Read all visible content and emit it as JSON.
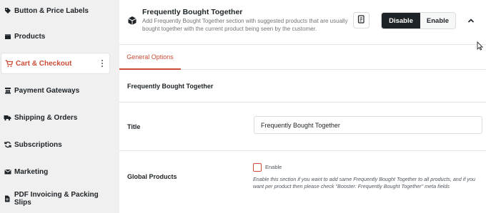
{
  "sidebar": {
    "items": [
      {
        "label": "Button & Price Labels",
        "icon": "tag-icon"
      },
      {
        "label": "Products",
        "icon": "box-icon"
      },
      {
        "label": "Cart & Checkout",
        "icon": "cart-icon",
        "active": true
      },
      {
        "label": "Payment Gateways",
        "icon": "payment-icon"
      },
      {
        "label": "Shipping & Orders",
        "icon": "truck-icon"
      },
      {
        "label": "Subscriptions",
        "icon": "refresh-icon"
      },
      {
        "label": "Marketing",
        "icon": "envelope-icon"
      },
      {
        "label": "PDF Invoicing & Packing Slips",
        "icon": "document-icon"
      }
    ]
  },
  "module": {
    "title": "Frequently Bought Together",
    "description": "Add Frequently Bought Together section with suggested products that are usually bought together with the current product being seen by the customer.",
    "disable_label": "Disable",
    "enable_label": "Enable"
  },
  "tabs": [
    {
      "label": "General Options",
      "active": true
    }
  ],
  "section": {
    "title": "Frequently Bought Together"
  },
  "fields": {
    "title": {
      "label": "Title",
      "value": "Frequently Bought Together"
    },
    "global_products": {
      "label": "Global Products",
      "checkbox_label": "Enable",
      "checked": false,
      "help": "Enable this section if you want to add same Frequently Bought Together to all products, and if you want per product then please check \"Booster: Frequently Bought Together\" meta fields"
    }
  },
  "colors": {
    "accent": "#cc4b36",
    "dark": "#1d2327"
  }
}
